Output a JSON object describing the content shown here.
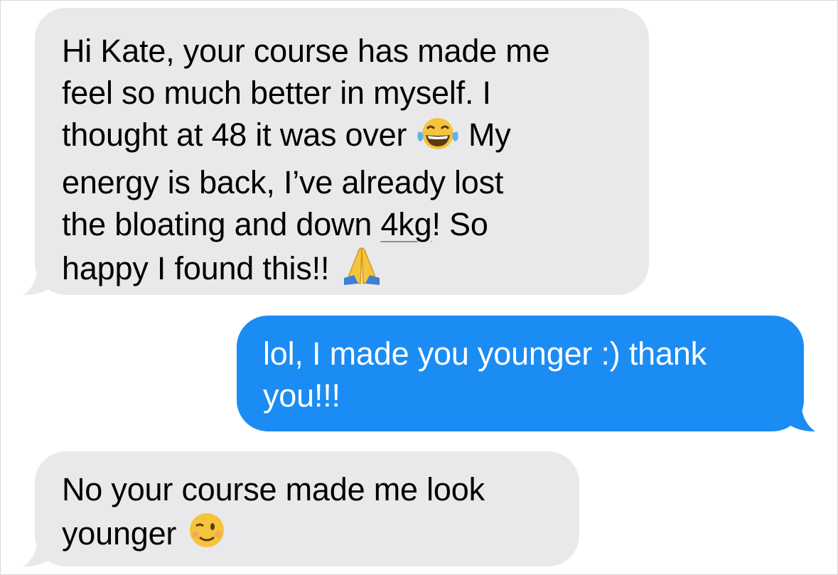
{
  "conversation": {
    "messages": [
      {
        "direction": "received",
        "lines": [
          "Hi Kate, your course has made me",
          "feel so much better in myself. I",
          "thought at 48 it was over",
          "My",
          "energy is back, I’ve already lost",
          "the bloating and down",
          "4kg",
          "! So",
          "happy I found this!!"
        ],
        "emojis": [
          "face-with-tears-of-joy",
          "folded-hands"
        ]
      },
      {
        "direction": "sent",
        "lines": [
          "lol, I made you younger :) thank",
          "you!!!"
        ]
      },
      {
        "direction": "received",
        "lines": [
          "No your course made me look",
          "younger"
        ],
        "emojis": [
          "winking-face"
        ]
      }
    ]
  },
  "colors": {
    "received_bubble": "#e9e9eb",
    "sent_bubble": "#1b8cf3",
    "received_text": "#000000",
    "sent_text": "#ffffff"
  }
}
